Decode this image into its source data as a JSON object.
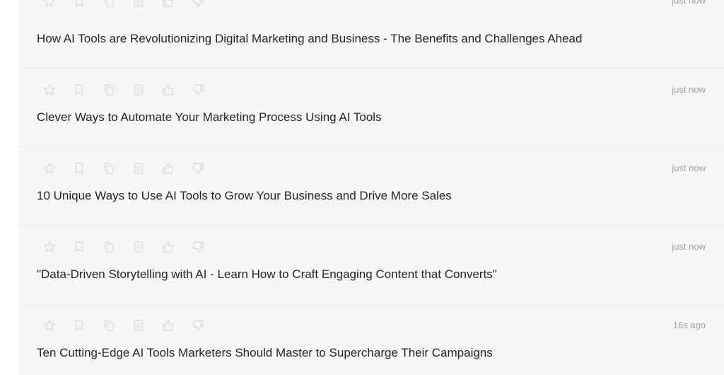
{
  "icons": [
    "star-icon",
    "bookmark-icon",
    "copy-icon",
    "document-icon",
    "thumbs-up-icon",
    "thumbs-down-icon"
  ],
  "items": [
    {
      "time": "just now",
      "title": "How AI Tools are Revolutionizing Digital Marketing and Business - The Benefits and Challenges Ahead"
    },
    {
      "time": "just now",
      "title": "Clever Ways to Automate Your Marketing Process Using AI Tools"
    },
    {
      "time": "just now",
      "title": "10 Unique Ways to Use AI Tools to Grow Your Business and Drive More Sales"
    },
    {
      "time": "just now",
      "title": "\"Data-Driven Storytelling with AI - Learn How to Craft Engaging Content that Converts\""
    },
    {
      "time": "16s ago",
      "title": "Ten Cutting-Edge AI Tools Marketers Should Master to Supercharge Their Campaigns"
    }
  ]
}
